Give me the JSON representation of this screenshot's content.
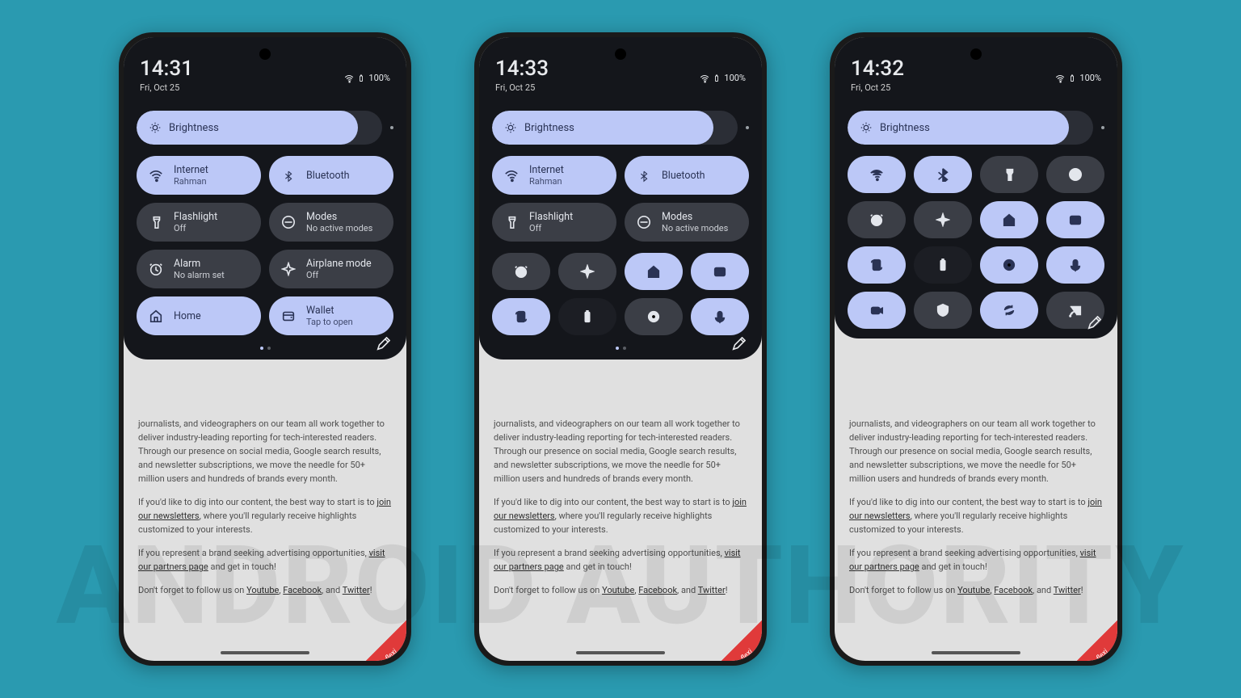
{
  "watermark": "ANDROID AUTHORITY",
  "phones": [
    {
      "time": "14:31",
      "date": "Fri, Oct 25",
      "battery": "100%",
      "brightness_label": "Brightness",
      "brightness_fill_pct": 90,
      "active_page": 0,
      "page_count": 2
    },
    {
      "time": "14:33",
      "date": "Fri, Oct 25",
      "battery": "100%",
      "brightness_label": "Brightness",
      "brightness_fill_pct": 90,
      "active_page": 0,
      "page_count": 2
    },
    {
      "time": "14:32",
      "date": "Fri, Oct 25",
      "battery": "100%",
      "brightness_label": "Brightness",
      "brightness_fill_pct": 90,
      "active_page": 0,
      "page_count": 1
    }
  ],
  "tiles_wide": [
    {
      "icon": "wifi",
      "title": "Internet",
      "sub": "Rahman",
      "active": true
    },
    {
      "icon": "bluetooth",
      "title": "Bluetooth",
      "sub": "",
      "active": true,
      "icon_pill": true
    },
    {
      "icon": "flashlight",
      "title": "Flashlight",
      "sub": "Off",
      "active": false
    },
    {
      "icon": "dnd",
      "title": "Modes",
      "sub": "No active modes",
      "active": false
    },
    {
      "icon": "alarm",
      "title": "Alarm",
      "sub": "No alarm set",
      "active": false
    },
    {
      "icon": "airplane",
      "title": "Airplane mode",
      "sub": "Off",
      "active": false
    },
    {
      "icon": "home",
      "title": "Home",
      "sub": "",
      "active": true
    },
    {
      "icon": "wallet",
      "title": "Wallet",
      "sub": "Tap to open",
      "active": true
    }
  ],
  "tiles_p2_top": [
    {
      "icon": "wifi",
      "title": "Internet",
      "sub": "Rahman",
      "active": true
    },
    {
      "icon": "bluetooth",
      "title": "Bluetooth",
      "sub": "",
      "active": true,
      "icon_pill": true
    },
    {
      "icon": "flashlight",
      "title": "Flashlight",
      "sub": "Off",
      "active": false
    },
    {
      "icon": "dnd",
      "title": "Modes",
      "sub": "No active modes",
      "active": false
    }
  ],
  "squares_p2": [
    {
      "icon": "alarm",
      "state": "off"
    },
    {
      "icon": "airplane",
      "state": "off"
    },
    {
      "icon": "home",
      "state": "on"
    },
    {
      "icon": "wallet",
      "state": "on"
    },
    {
      "icon": "rotate",
      "state": "on"
    },
    {
      "icon": "battery",
      "state": "dark"
    },
    {
      "icon": "record",
      "state": "off"
    },
    {
      "icon": "mic",
      "state": "on"
    }
  ],
  "squares_p3": [
    {
      "icon": "wifi",
      "state": "on"
    },
    {
      "icon": "bluetooth",
      "state": "on"
    },
    {
      "icon": "flashlight",
      "state": "off"
    },
    {
      "icon": "dnd",
      "state": "off"
    },
    {
      "icon": "alarm",
      "state": "off"
    },
    {
      "icon": "airplane",
      "state": "off"
    },
    {
      "icon": "home",
      "state": "on"
    },
    {
      "icon": "wallet",
      "state": "on"
    },
    {
      "icon": "rotate",
      "state": "on"
    },
    {
      "icon": "battery",
      "state": "dark"
    },
    {
      "icon": "record",
      "state": "on"
    },
    {
      "icon": "mic",
      "state": "on"
    },
    {
      "icon": "camera",
      "state": "on"
    },
    {
      "icon": "shield",
      "state": "off"
    },
    {
      "icon": "sync",
      "state": "on"
    },
    {
      "icon": "cast",
      "state": "off"
    }
  ],
  "article": {
    "p1": "journalists, and videographers on our team all work together to deliver industry-leading reporting for tech-interested readers. Through our presence on social media, Google search results, and newsletter subscriptions, we move the needle for 50+ million users and hundreds of brands every month.",
    "p2a": "If you'd like to dig into our content, the best way to start is to ",
    "p2link": "join our newsletters",
    "p2b": ", where you'll regularly receive highlights customized to your interests.",
    "p3a": "If you represent a brand seeking advertising opportunities, ",
    "p3link": "visit our partners page",
    "p3b": " and get in touch!",
    "p4a": "Don't forget to follow us on ",
    "yt": "Youtube",
    "fb": "Facebook",
    "tw": "Twitter",
    "and": ", and ",
    "comma": ", ",
    "excl": "!"
  },
  "flexi": "flexi"
}
